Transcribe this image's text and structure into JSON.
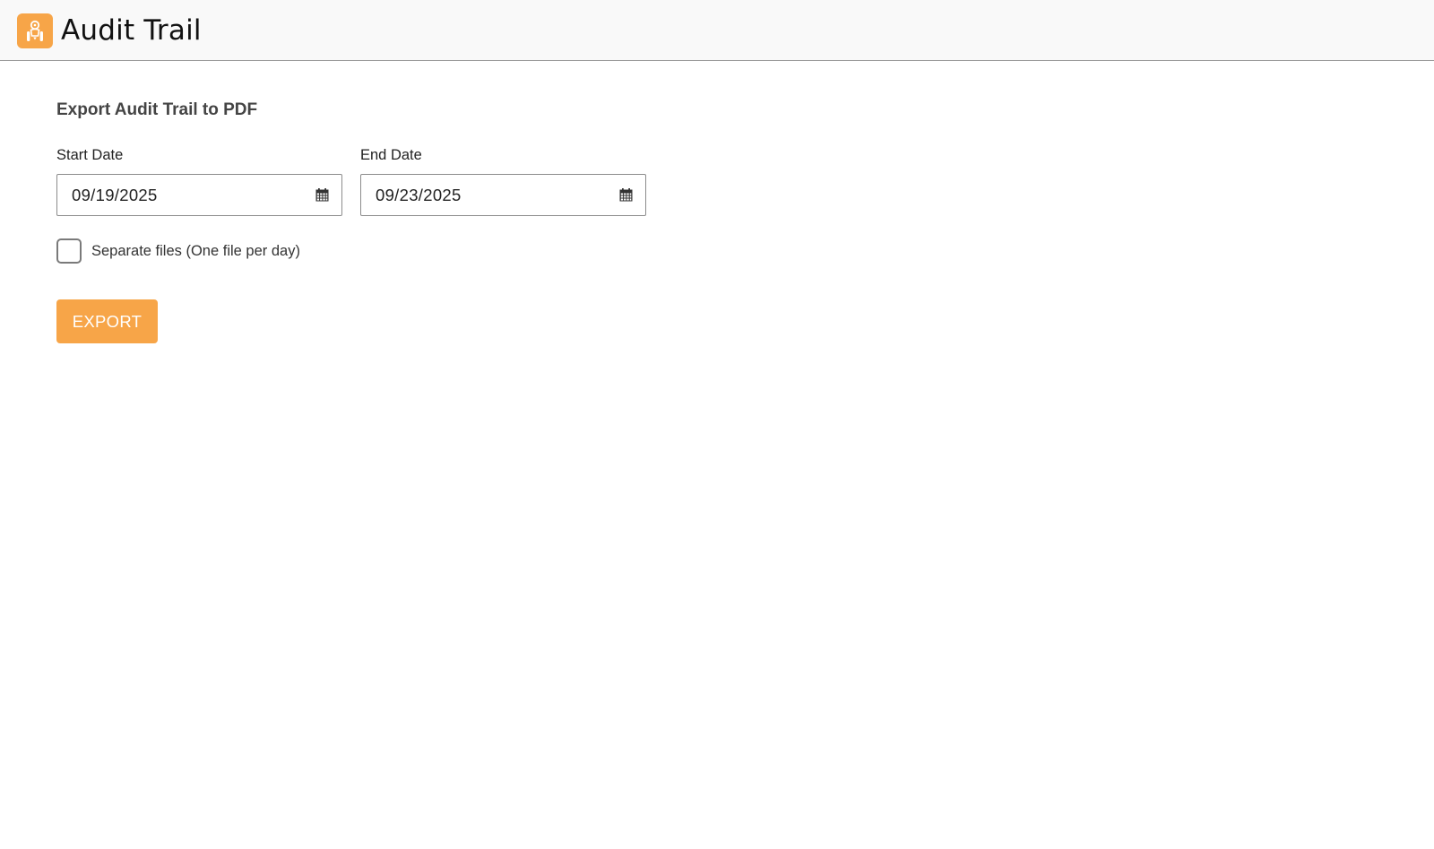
{
  "header": {
    "title": "Audit Trail",
    "logo_icon": "audit-logo-icon",
    "accent_color": "#f7a548"
  },
  "export_form": {
    "section_title": "Export Audit Trail to PDF",
    "start_date": {
      "label": "Start Date",
      "value": "09/19/2025",
      "icon": "calendar-icon"
    },
    "end_date": {
      "label": "End Date",
      "value": "09/23/2025",
      "icon": "calendar-icon"
    },
    "separate_files": {
      "label": "Separate files (One file per day)",
      "checked": false
    },
    "export_label": "EXPORT"
  }
}
